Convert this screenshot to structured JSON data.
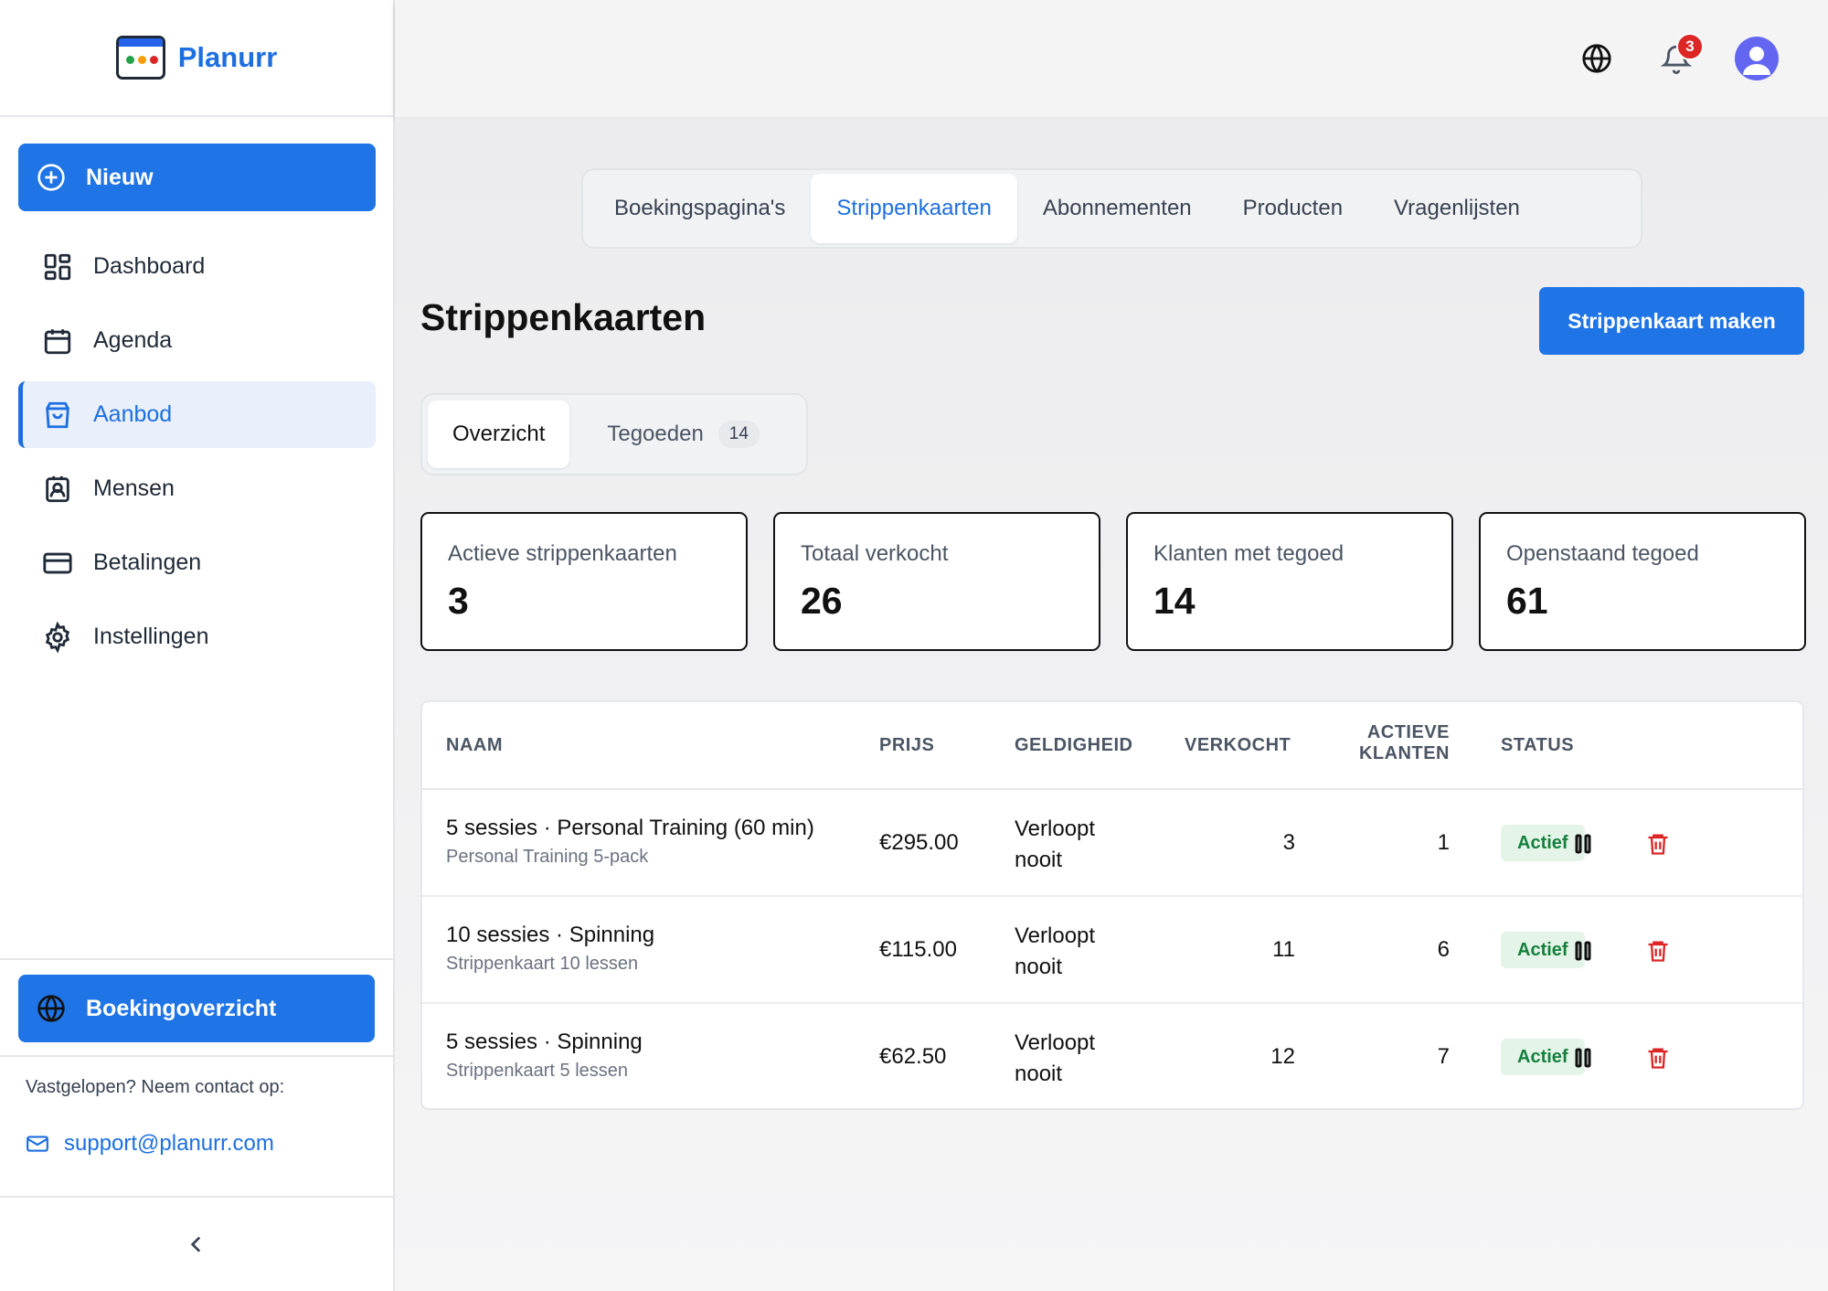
{
  "brand": {
    "name": "Planurr"
  },
  "sidebar": {
    "new_label": "Nieuw",
    "items": [
      {
        "label": "Dashboard",
        "icon": "dashboard-icon"
      },
      {
        "label": "Agenda",
        "icon": "calendar-icon"
      },
      {
        "label": "Aanbod",
        "icon": "bag-icon"
      },
      {
        "label": "Mensen",
        "icon": "contact-icon"
      },
      {
        "label": "Betalingen",
        "icon": "card-icon"
      },
      {
        "label": "Instellingen",
        "icon": "gear-icon"
      }
    ],
    "booking_label": "Boekingoverzicht",
    "help_text": "Vastgelopen? Neem contact op:",
    "support_email": "support@planurr.com"
  },
  "header": {
    "notifications_count": "3"
  },
  "tabs": [
    "Boekingspagina's",
    "Strippenkaarten",
    "Abonnementen",
    "Producten",
    "Vragenlijsten"
  ],
  "page": {
    "title": "Strippenkaarten",
    "create_label": "Strippenkaart maken",
    "subtabs": {
      "overview": "Overzicht",
      "credits": "Tegoeden",
      "credits_count": "14"
    }
  },
  "stats": [
    {
      "label": "Actieve strippenkaarten",
      "value": "3"
    },
    {
      "label": "Totaal verkocht",
      "value": "26"
    },
    {
      "label": "Klanten met tegoed",
      "value": "14"
    },
    {
      "label": "Openstaand tegoed",
      "value": "61"
    }
  ],
  "table": {
    "headers": {
      "name": "NAAM",
      "price": "PRIJS",
      "validity": "GELDIGHEID",
      "sold": "VERKOCHT",
      "active_1": "ACTIEVE",
      "active_2": "KLANTEN",
      "status": "STATUS"
    },
    "rows": [
      {
        "name": "5 sessies · Personal Training (60 min)",
        "sub": "Personal Training 5-pack",
        "price": "€295.00",
        "validity_1": "Verloopt",
        "validity_2": "nooit",
        "sold": "3",
        "active": "1",
        "status": "Actief"
      },
      {
        "name": "10 sessies · Spinning",
        "sub": "Strippenkaart 10 lessen",
        "price": "€115.00",
        "validity_1": "Verloopt",
        "validity_2": "nooit",
        "sold": "11",
        "active": "6",
        "status": "Actief"
      },
      {
        "name": "5 sessies · Spinning",
        "sub": "Strippenkaart 5 lessen",
        "price": "€62.50",
        "validity_1": "Verloopt",
        "validity_2": "nooit",
        "sold": "12",
        "active": "7",
        "status": "Actief"
      }
    ]
  },
  "colors": {
    "accent": "#1f74e6",
    "danger": "#dc2626",
    "success": "#15803d"
  }
}
